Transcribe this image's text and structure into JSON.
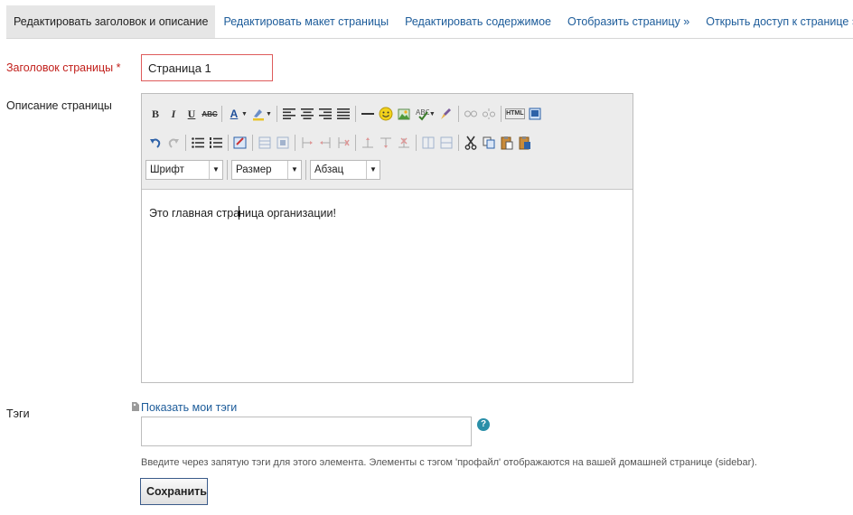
{
  "tabs": [
    {
      "label": "Редактировать заголовок и описание",
      "active": true
    },
    {
      "label": "Редактировать макет страницы",
      "active": false
    },
    {
      "label": "Редактировать содержимое",
      "active": false
    },
    {
      "label": "Отобразить страницу »",
      "active": false
    },
    {
      "label": "Открыть доступ к странице »",
      "active": false
    }
  ],
  "form": {
    "title_label": "Заголовок страницы *",
    "title_value": "Страница 1",
    "description_label": "Описание страницы",
    "tags_label": "Тэги",
    "show_tags_link": "Показать мои тэги",
    "tags_value": "",
    "tags_hint": "Введите через запятую тэги для этого элемента. Элементы с тэгом 'профайл' отображаются на вашей домашней странице (sidebar).",
    "save_label": "Сохранить"
  },
  "editor": {
    "content_before_caret": "Это главная стра",
    "content_after_caret": "ница организации!",
    "font_select": "Шрифт",
    "size_select": "Размер",
    "format_select": "Абзац",
    "html_button": "HTML"
  },
  "colors": {
    "link": "#1d5c9a",
    "required_label": "#c2201c",
    "title_input_border": "#de5b5b",
    "active_tab_bg": "#e6e6e6"
  }
}
